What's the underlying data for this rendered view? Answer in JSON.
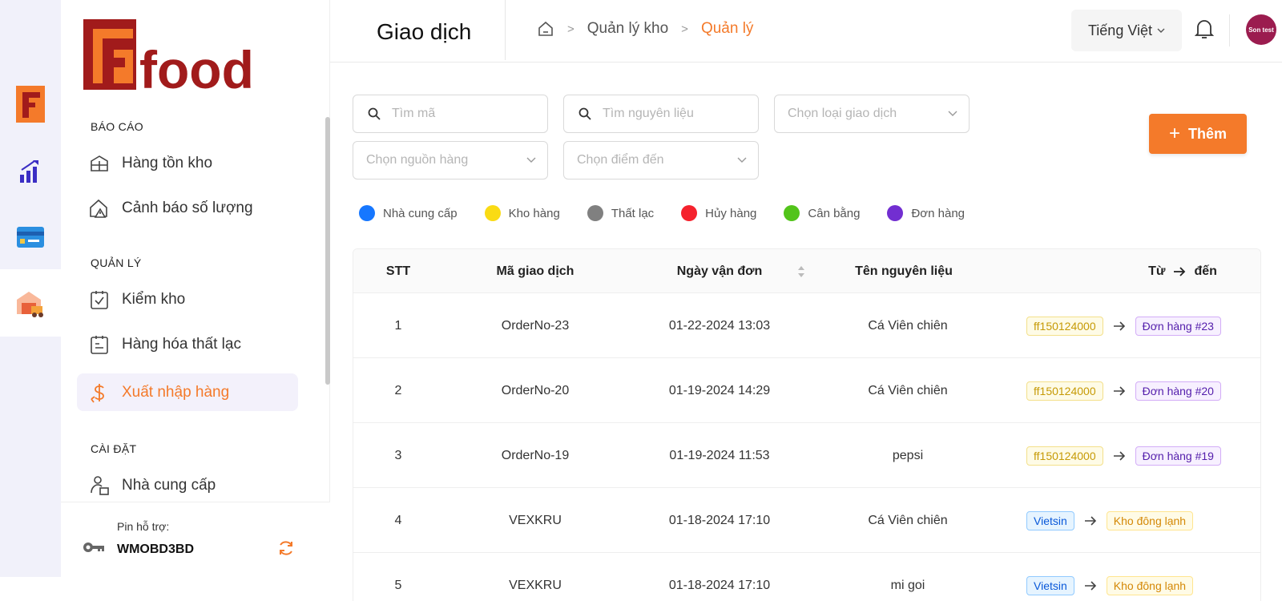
{
  "brand": {
    "logo_f": "F",
    "logo_text": "food"
  },
  "sidebar": {
    "sections": [
      {
        "title": "BÁO CÁO",
        "items": [
          {
            "label": "Hàng tồn kho",
            "icon": "warehouse-icon"
          },
          {
            "label": "Cảnh báo số lượng",
            "icon": "house-warning-icon"
          }
        ]
      },
      {
        "title": "QUẢN LÝ",
        "items": [
          {
            "label": "Kiểm kho",
            "icon": "clipboard-check-icon"
          },
          {
            "label": "Hàng hóa thất lạc",
            "icon": "clipboard-lost-icon"
          },
          {
            "label": "Xuất nhập hàng",
            "icon": "dollar-exchange-icon",
            "active": true
          }
        ]
      },
      {
        "title": "CÀI ĐẶT",
        "items": [
          {
            "label": "Nhà cung cấp",
            "icon": "supplier-icon"
          }
        ]
      }
    ],
    "pin_label": "Pin hỗ trợ:",
    "pin_code": "WMOBD3BD"
  },
  "header": {
    "title": "Giao dịch",
    "breadcrumb": [
      "Quản lý kho",
      "Quản lý"
    ],
    "language": "Tiếng Việt",
    "avatar_text": "Son test"
  },
  "filters": {
    "search_code": "Tìm mã",
    "search_ingredient": "Tìm nguyên liệu",
    "transaction_type": "Chọn loại giao dịch",
    "source": "Chọn nguồn hàng",
    "destination": "Chọn điểm đến",
    "add_label": "Thêm"
  },
  "legend": [
    {
      "label": "Nhà cung cấp",
      "color": "#1677ff"
    },
    {
      "label": "Kho hàng",
      "color": "#fadb14"
    },
    {
      "label": "Thất lạc",
      "color": "#808080"
    },
    {
      "label": "Hủy hàng",
      "color": "#f5222d"
    },
    {
      "label": "Cân bằng",
      "color": "#52c41a"
    },
    {
      "label": "Đơn hàng",
      "color": "#722ed1"
    }
  ],
  "table": {
    "headers": {
      "stt": "STT",
      "code": "Mã giao dịch",
      "date": "Ngày vận đơn",
      "ingredient": "Tên nguyên liệu",
      "from": "Từ",
      "to": "đến"
    },
    "rows": [
      {
        "stt": "1",
        "code": "OrderNo-23",
        "date": "01-22-2024 13:03",
        "ingredient": "Cá Viên chiên",
        "from": "ff150124000",
        "from_color": "yellow",
        "to": "Đơn hàng #23",
        "to_color": "purple"
      },
      {
        "stt": "2",
        "code": "OrderNo-20",
        "date": "01-19-2024 14:29",
        "ingredient": "Cá Viên chiên",
        "from": "ff150124000",
        "from_color": "yellow",
        "to": "Đơn hàng #20",
        "to_color": "purple"
      },
      {
        "stt": "3",
        "code": "OrderNo-19",
        "date": "01-19-2024 11:53",
        "ingredient": "pepsi",
        "from": "ff150124000",
        "from_color": "yellow",
        "to": "Đơn hàng #19",
        "to_color": "purple"
      },
      {
        "stt": "4",
        "code": "VEXKRU",
        "date": "01-18-2024 17:10",
        "ingredient": "Cá Viên chiên",
        "from": "Vietsin",
        "from_color": "blue",
        "to": "Kho đông lạnh",
        "to_color": "gold"
      },
      {
        "stt": "5",
        "code": "VEXKRU",
        "date": "01-18-2024 17:10",
        "ingredient": "mi goi",
        "from": "Vietsin",
        "from_color": "blue",
        "to": "Kho đông lạnh",
        "to_color": "gold"
      }
    ]
  }
}
